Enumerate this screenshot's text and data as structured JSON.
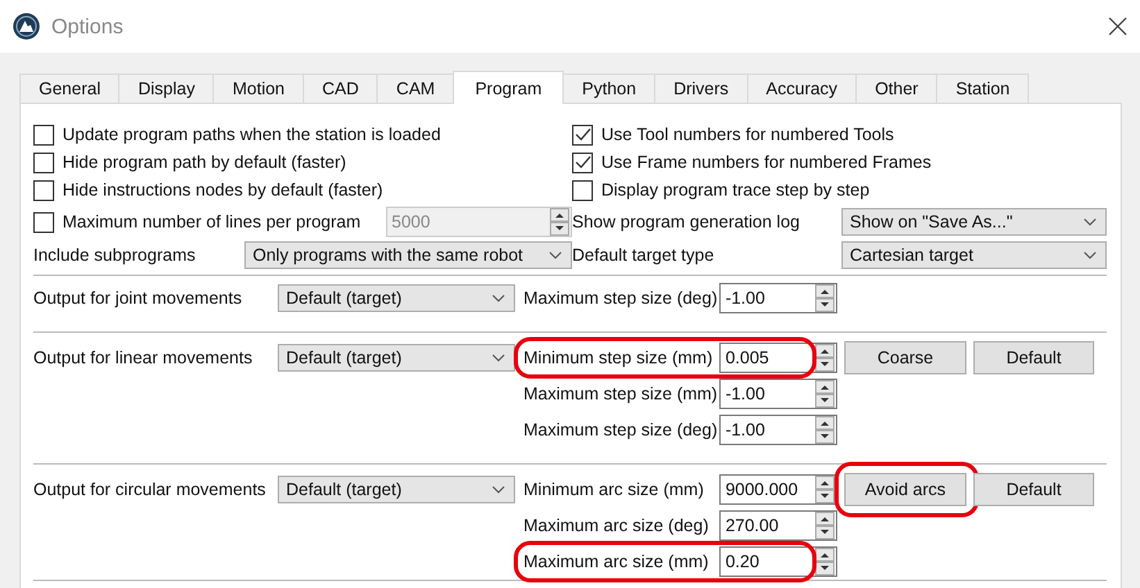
{
  "window": {
    "title": "Options"
  },
  "tabs": [
    {
      "label": "General",
      "selected": false
    },
    {
      "label": "Display",
      "selected": false
    },
    {
      "label": "Motion",
      "selected": false
    },
    {
      "label": "CAD",
      "selected": false
    },
    {
      "label": "CAM",
      "selected": false
    },
    {
      "label": "Program",
      "selected": true
    },
    {
      "label": "Python",
      "selected": false
    },
    {
      "label": "Drivers",
      "selected": false
    },
    {
      "label": "Accuracy",
      "selected": false
    },
    {
      "label": "Other",
      "selected": false
    },
    {
      "label": "Station",
      "selected": false
    }
  ],
  "left_options": [
    {
      "label": "Update program paths when the station is loaded",
      "checked": false
    },
    {
      "label": "Hide program path by default (faster)",
      "checked": false
    },
    {
      "label": "Hide instructions nodes by default (faster)",
      "checked": false
    }
  ],
  "max_lines": {
    "label": "Maximum number of lines per program",
    "checked": false,
    "value": "5000",
    "disabled": true
  },
  "include_subprograms": {
    "label": "Include subprograms",
    "value": "Only programs with the same robot"
  },
  "right_options": [
    {
      "label": "Use Tool numbers for numbered Tools",
      "checked": true
    },
    {
      "label": "Use Frame numbers for numbered Frames",
      "checked": true
    },
    {
      "label": "Display program trace step by step",
      "checked": false
    }
  ],
  "right_selects": [
    {
      "label": "Show program generation log",
      "value": "Show on \"Save As...\""
    },
    {
      "label": "Default target type",
      "value": "Cartesian target"
    }
  ],
  "sections": [
    {
      "label": "Output for joint movements",
      "dropdown": "Default (target)",
      "fields": [
        {
          "label": "Maximum step size (deg)",
          "value": "-1.00",
          "highlighted": false
        }
      ]
    },
    {
      "label": "Output for linear movements",
      "dropdown": "Default (target)",
      "fields": [
        {
          "label": "Minimum step size (mm)",
          "value": "0.005",
          "highlighted": true
        },
        {
          "label": "Maximum step size (mm)",
          "value": "-1.00",
          "highlighted": false
        },
        {
          "label": "Maximum step size (deg)",
          "value": "-1.00",
          "highlighted": false
        }
      ],
      "buttons": [
        {
          "label": "Coarse",
          "highlighted": false
        },
        {
          "label": "Default",
          "highlighted": false
        }
      ]
    },
    {
      "label": "Output for circular movements",
      "dropdown": "Default (target)",
      "fields": [
        {
          "label": "Minimum arc size (mm)",
          "value": "9000.000",
          "highlighted": false
        },
        {
          "label": "Maximum arc size (deg)",
          "value": "270.00",
          "highlighted": false
        },
        {
          "label": "Maximum arc size (mm)",
          "value": "0.20",
          "highlighted": true
        }
      ],
      "buttons": [
        {
          "label": "Avoid arcs",
          "highlighted": true
        },
        {
          "label": "Default",
          "highlighted": false
        }
      ]
    }
  ]
}
